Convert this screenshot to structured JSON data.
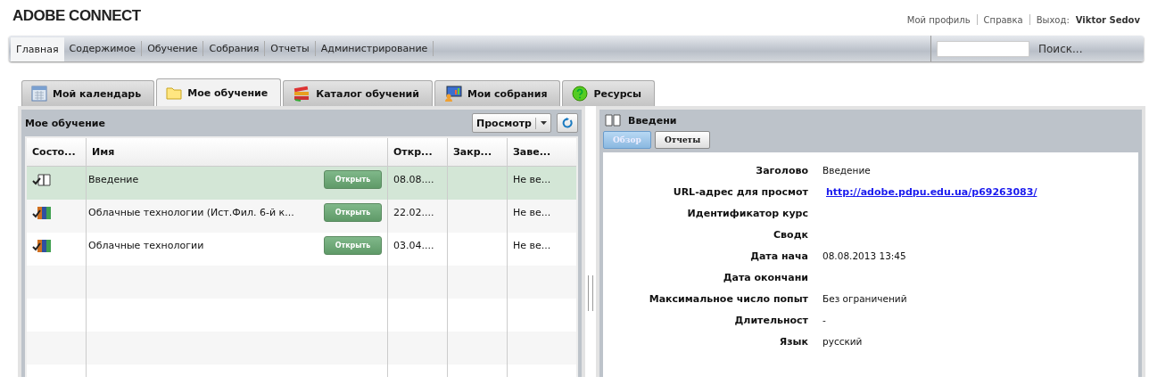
{
  "logo": "ADOBE CONNECT",
  "user_links": [
    {
      "label": "Мой профиль",
      "kind": "link"
    },
    {
      "label": "Справка",
      "kind": "link"
    },
    {
      "label": "Выход:",
      "kind": "link"
    },
    {
      "label": "Viktor Sedov",
      "kind": "user"
    }
  ],
  "nav": [
    {
      "label": "Главная",
      "selected": true
    },
    {
      "label": "Содержимое",
      "selected": false
    },
    {
      "label": "Обучение",
      "selected": false
    },
    {
      "label": "Собрания",
      "selected": false
    },
    {
      "label": "Отчеты",
      "selected": false
    },
    {
      "label": "Администрирование",
      "selected": false
    }
  ],
  "search": {
    "button": "Поиск..."
  },
  "tabs": [
    {
      "label": "Мой календарь",
      "kind": "calendar",
      "selected": false
    },
    {
      "label": "Мое обучение",
      "kind": "folder",
      "selected": true
    },
    {
      "label": "Каталог обучений",
      "kind": "books",
      "selected": false
    },
    {
      "label": "Мои собрания",
      "kind": "meeting",
      "selected": false
    },
    {
      "label": "Ресурсы",
      "kind": "help",
      "selected": false
    }
  ],
  "list_panel": {
    "title": "Мое обучение",
    "view_button": "Просмотр",
    "columns": [
      "Состо...",
      "Имя",
      "Откр...",
      "Закр...",
      "Заве..."
    ],
    "rows": [
      {
        "kind": "course",
        "name": "Введение",
        "action": "Открыть",
        "opened": "08.08....",
        "completed": "Не ве...",
        "selected": true
      },
      {
        "kind": "curriculum",
        "name": "Облачные технологии (Ист.Фил. 6-й к...",
        "action": "Открыть",
        "opened": "22.02....",
        "completed": "Не ве...",
        "selected": false
      },
      {
        "kind": "curriculum",
        "name": "Облачные технологии",
        "action": "Открыть",
        "opened": "03.04....",
        "completed": "Не ве...",
        "selected": false
      }
    ]
  },
  "detail_panel": {
    "title": "Введени",
    "subtabs": [
      {
        "label": "Обзор",
        "selected": true
      },
      {
        "label": "Отчеты",
        "selected": false
      }
    ],
    "fields": [
      {
        "label": "Заголово",
        "value": "Введение",
        "kind": "text"
      },
      {
        "label": "URL-адрес для просмот",
        "value": "http://adobe.pdpu.edu.ua/p69263083/",
        "kind": "link"
      },
      {
        "label": "Идентификатор курс"
      },
      {
        "label": "Сводк"
      },
      {
        "label": "Дата нача",
        "value": "08.08.2013 13:45",
        "kind": "text"
      },
      {
        "label": "Дата окончани"
      },
      {
        "label": "Максимальное число попыт",
        "value": "Без ограничений",
        "kind": "text"
      },
      {
        "label": "Длительност",
        "value": "-",
        "kind": "text"
      },
      {
        "label": "Язык",
        "value": "русский",
        "kind": "text"
      }
    ]
  }
}
